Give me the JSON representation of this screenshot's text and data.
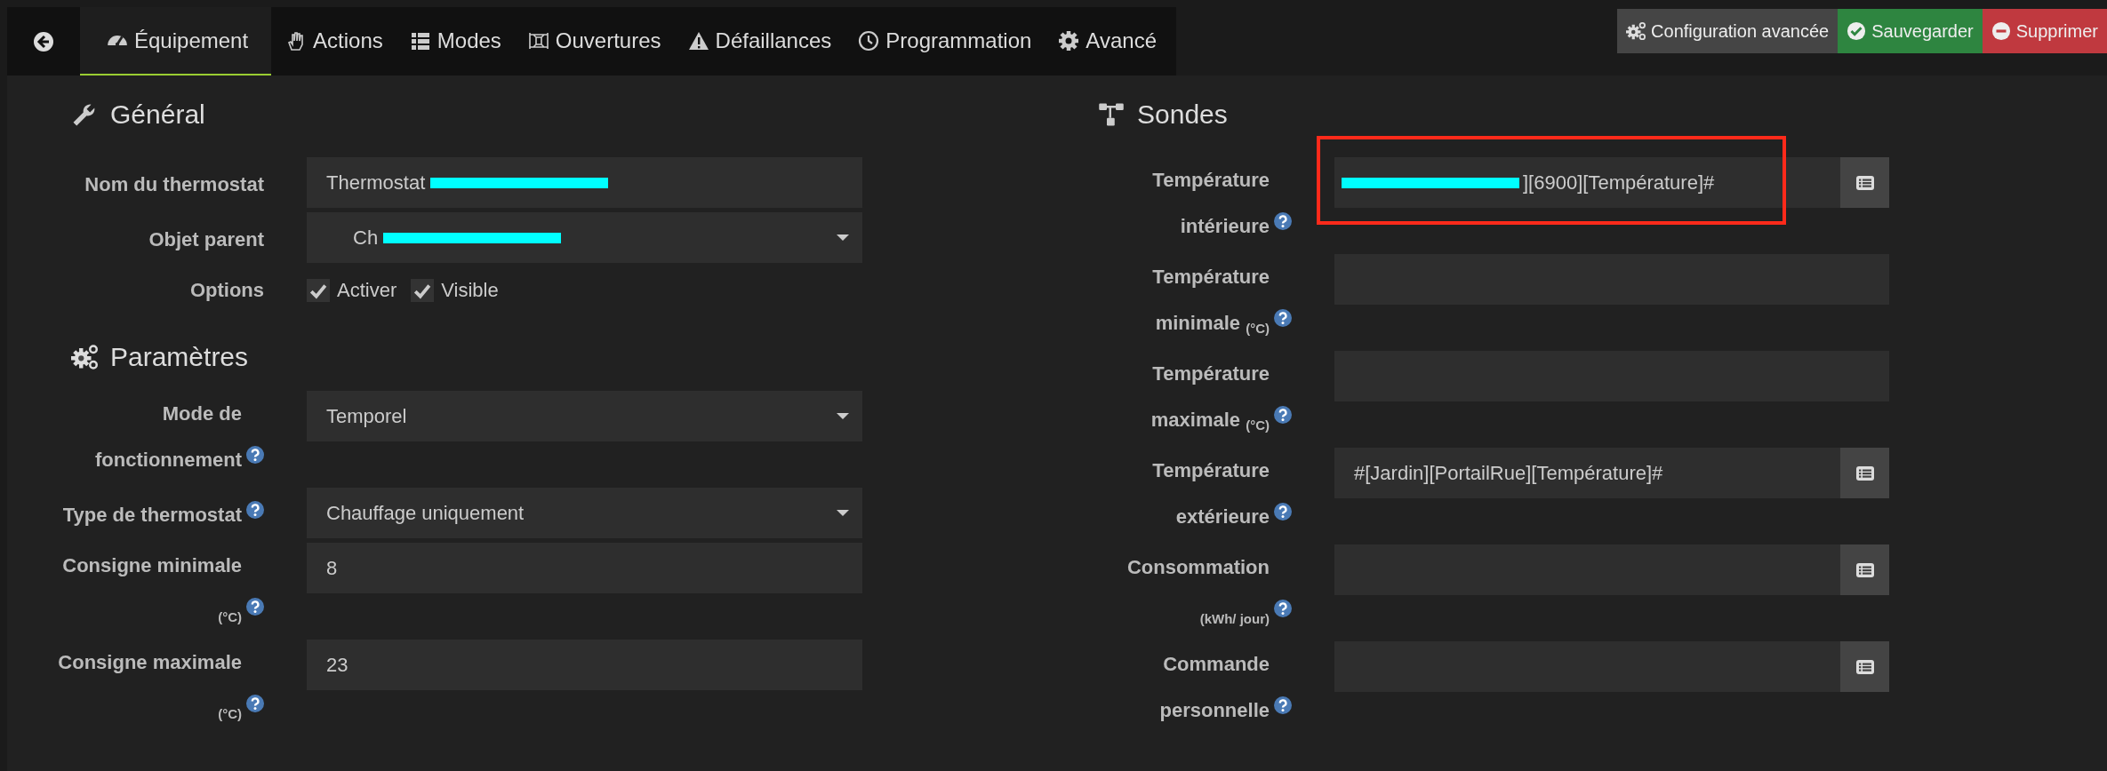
{
  "nav": {
    "tabs": [
      {
        "label": "Équipement",
        "selected": true
      },
      {
        "label": "Actions",
        "selected": false
      },
      {
        "label": "Modes",
        "selected": false
      },
      {
        "label": "Ouvertures",
        "selected": false
      },
      {
        "label": "Défaillances",
        "selected": false
      },
      {
        "label": "Programmation",
        "selected": false
      },
      {
        "label": "Avancé",
        "selected": false
      }
    ]
  },
  "actions": [
    {
      "label": "Configuration avancée",
      "kind": "config"
    },
    {
      "label": "Sauvegarder",
      "kind": "save"
    },
    {
      "label": "Supprimer",
      "kind": "delete"
    }
  ],
  "columns": [
    {
      "sections": [
        {
          "title": "Général",
          "fields": [
            {
              "label": "Nom du thermostat",
              "help": false,
              "kind": "text",
              "value": "Thermostat",
              "redacted_after": true
            },
            {
              "label": "Objet parent",
              "help": false,
              "kind": "select",
              "value": "Ch",
              "redacted_after": true
            },
            {
              "label": "Options",
              "help": false,
              "kind": "checkboxes",
              "options": [
                {
                  "label": "Activer",
                  "checked": true
                },
                {
                  "label": "Visible",
                  "checked": true
                }
              ]
            }
          ]
        },
        {
          "title": "Paramètres",
          "fields": [
            {
              "label": "Mode de fonctionnement",
              "help": true,
              "kind": "select",
              "value": "Temporel"
            },
            {
              "label": "Type de thermostat",
              "help": true,
              "kind": "select",
              "value": "Chauffage uniquement"
            },
            {
              "label": "Consigne minimale $_{(°C)}$",
              "help": true,
              "kind": "text",
              "value": "8"
            },
            {
              "label": "Consigne maximale $_{(°C)}$",
              "help": true,
              "kind": "text",
              "value": "23"
            }
          ]
        }
      ]
    },
    {
      "sections": [
        {
          "title": "Sondes",
          "fields": [
            {
              "label": "Température intérieure",
              "help": true,
              "kind": "cmd",
              "value": "][6900][Température]#",
              "redacted_before": true,
              "highlighted": true
            },
            {
              "label": "Température minimale $_{(°C)}$",
              "help": true,
              "kind": "text"
            },
            {
              "label": "Température maximale $_{(°C)}$",
              "help": true,
              "kind": "text"
            },
            {
              "label": "Température extérieure",
              "help": true,
              "kind": "cmd",
              "value": "#[Jardin][PortailRue][Température]#"
            },
            {
              "label": "Consommation $_{(kWh/ jour)}$",
              "help": true,
              "kind": "cmd"
            },
            {
              "label": "Commande personnelle",
              "help": true,
              "kind": "cmd"
            }
          ]
        }
      ]
    }
  ]
}
